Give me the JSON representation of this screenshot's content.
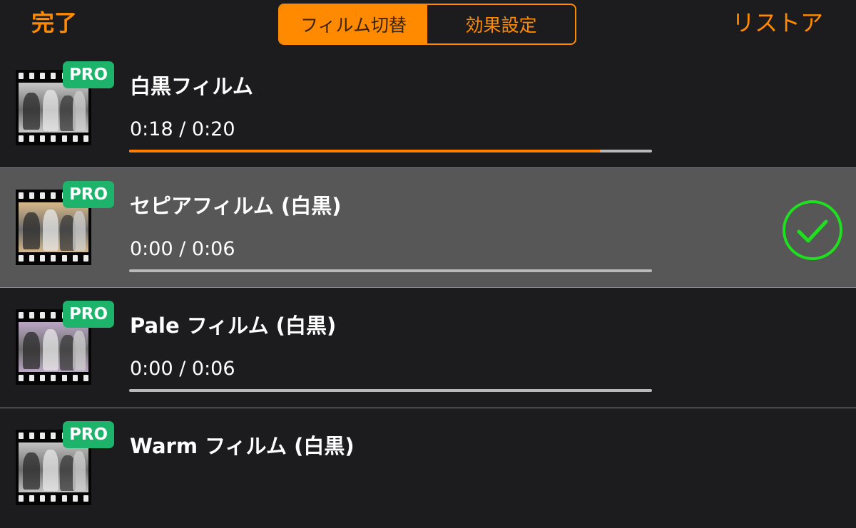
{
  "topbar": {
    "done_label": "完了",
    "restore_label": "リストア",
    "tabs": [
      {
        "label": "フィルム切替",
        "active": true
      },
      {
        "label": "効果設定",
        "active": false
      }
    ]
  },
  "colors": {
    "accent": "#ff8a00",
    "progress": "#ff7f00",
    "pro_badge": "#1db36b",
    "check": "#1fe01f",
    "selected_row": "#575757",
    "background": "#1c1c1e"
  },
  "films": [
    {
      "title": "白黒フィルム",
      "time": "0:18 / 0:20",
      "progress": 0.9,
      "badge": "PRO",
      "tint": "#c8c8c8",
      "selected": false
    },
    {
      "title": "セピアフィルム (白黒)",
      "time": "0:00 / 0:06",
      "progress": 0,
      "badge": "PRO",
      "tint": "#d7b889",
      "selected": true,
      "selected_icon": "checkmark-circle-icon"
    },
    {
      "title": "Pale フィルム (白黒)",
      "time": "0:00 / 0:06",
      "progress": 0,
      "badge": "PRO",
      "tint": "#b9a6c4",
      "selected": false
    },
    {
      "title": "Warm フィルム (白黒)",
      "time": "",
      "progress": 0,
      "badge": "PRO",
      "tint": "#c2c2c2",
      "selected": false
    }
  ]
}
